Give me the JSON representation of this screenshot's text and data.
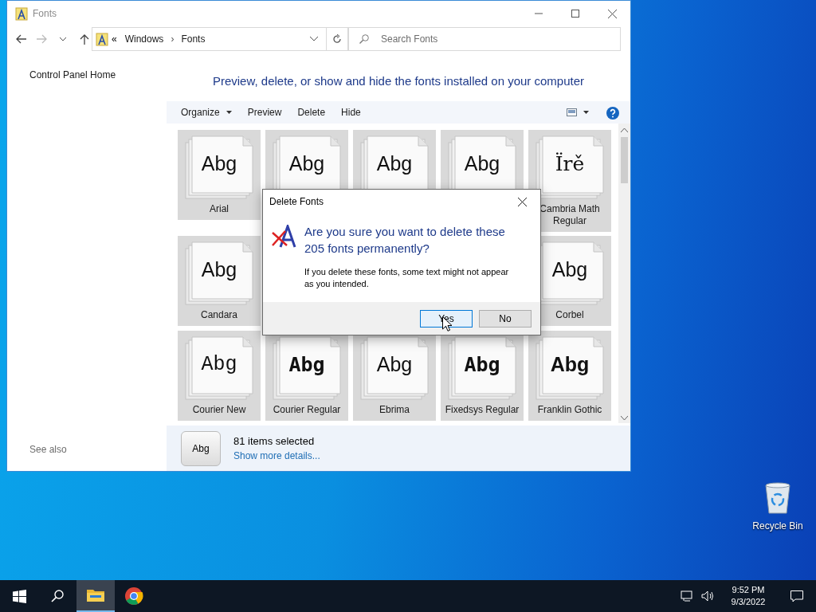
{
  "window": {
    "title": "Fonts",
    "address": {
      "prefix": "«",
      "path": [
        "Windows",
        "Fonts"
      ],
      "separator": "›"
    },
    "search": {
      "placeholder": "Search Fonts"
    }
  },
  "sidebar": {
    "links": [
      "Control Panel Home"
    ],
    "see_also": "See also"
  },
  "heading": "Preview, delete, or show and hide the fonts installed on your computer",
  "toolbar": {
    "buttons": [
      {
        "label": "Organize",
        "dropdown": true
      },
      {
        "label": "Preview",
        "dropdown": false
      },
      {
        "label": "Delete",
        "dropdown": false
      },
      {
        "label": "Hide",
        "dropdown": false
      }
    ]
  },
  "tiles": [
    {
      "kind": "sans",
      "preview": "Abg",
      "name": "Arial",
      "selected": true
    },
    {
      "kind": "sans",
      "preview": "Abg",
      "selected": true
    },
    {
      "kind": "sans",
      "preview": "Abg",
      "selected": true
    },
    {
      "kind": "sans",
      "preview": "Abg",
      "selected": true
    },
    {
      "kind": "serif",
      "preview": "Ïrě",
      "name": "Cambria Math Regular",
      "selected": true
    },
    {
      "kind": "sans",
      "preview": "Abg",
      "name": "Candara",
      "selected": true
    },
    {
      "kind": "covered"
    },
    {
      "kind": "covered"
    },
    {
      "kind": "covered"
    },
    {
      "kind": "sans",
      "preview": "Abg",
      "name": "Corbel",
      "selected": true
    },
    {
      "kind": "mono",
      "preview": "Abg",
      "name": "Courier New",
      "selected": true
    },
    {
      "kind": "monobold",
      "preview": "Abg",
      "name": "Courier Regular",
      "selected": true
    },
    {
      "kind": "sans",
      "preview": "Abg",
      "name": "Ebrima",
      "selected": true
    },
    {
      "kind": "monobold",
      "preview": "Abg",
      "name": "Fixedsys Regular",
      "selected": true
    },
    {
      "kind": "bold",
      "preview": "Abg",
      "name": "Franklin Gothic",
      "selected": true
    }
  ],
  "details": {
    "preview": "Abg",
    "summary": "81 items selected",
    "link": "Show more details..."
  },
  "dialog": {
    "title": "Delete Fonts",
    "question": "Are you sure you want to delete these 205 fonts permanently?",
    "message": "If you delete these fonts, some text might not appear as you intended.",
    "buttons": [
      {
        "label": "Yes",
        "focused": true
      },
      {
        "label": "No",
        "focused": false
      }
    ]
  },
  "desktop_icons": [
    {
      "label": "Recycle Bin"
    }
  ],
  "taskbar": {
    "apps": [
      {
        "kind": "explorer",
        "active": true
      },
      {
        "kind": "chrome",
        "active": false
      }
    ],
    "time": "9:52 PM",
    "date": "9/3/2022"
  }
}
